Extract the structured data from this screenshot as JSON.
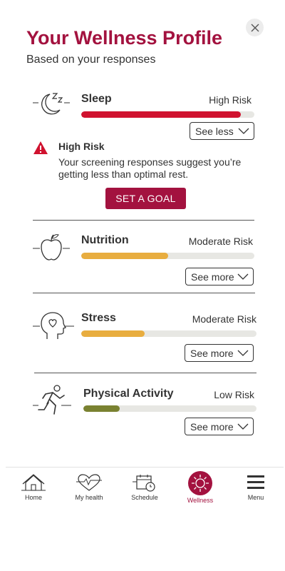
{
  "header": {
    "title": "Your Wellness Profile",
    "subtitle": "Based on your responses",
    "close_icon": "close-icon"
  },
  "colors": {
    "brand": "#a3123f",
    "high_risk": "#d0122f",
    "moderate_risk": "#e8ad3f",
    "low_risk": "#7a8231",
    "track": "#e7e7e3"
  },
  "categories": [
    {
      "name": "Sleep",
      "risk": "High Risk",
      "toggle": "See less",
      "level": 0.92,
      "icon": "sleep-moon-icon"
    },
    {
      "name": "Nutrition",
      "risk": "Moderate Risk",
      "toggle": "See more",
      "level": 0.5,
      "icon": "apple-icon"
    },
    {
      "name": "Stress",
      "risk": "Moderate Risk",
      "toggle": "See more",
      "level": 0.36,
      "icon": "head-heart-icon"
    },
    {
      "name": "Physical Activity",
      "risk": "Low Risk",
      "toggle": "See more",
      "level": 0.21,
      "icon": "running-person-icon"
    }
  ],
  "sleep_detail": {
    "title": "High Risk",
    "text": "Your screening responses suggest you’re getting less than optimal rest.",
    "button": "SET A GOAL",
    "icon": "alert-icon"
  },
  "nav": {
    "items": [
      {
        "label": "Home",
        "icon": "home-icon"
      },
      {
        "label": "My health",
        "icon": "heart-pulse-icon"
      },
      {
        "label": "Schedule",
        "icon": "calendar-clock-icon"
      },
      {
        "label": "Wellness",
        "icon": "wellness-sun-icon",
        "active": true
      },
      {
        "label": "Menu",
        "icon": "hamburger-menu-icon"
      }
    ]
  }
}
